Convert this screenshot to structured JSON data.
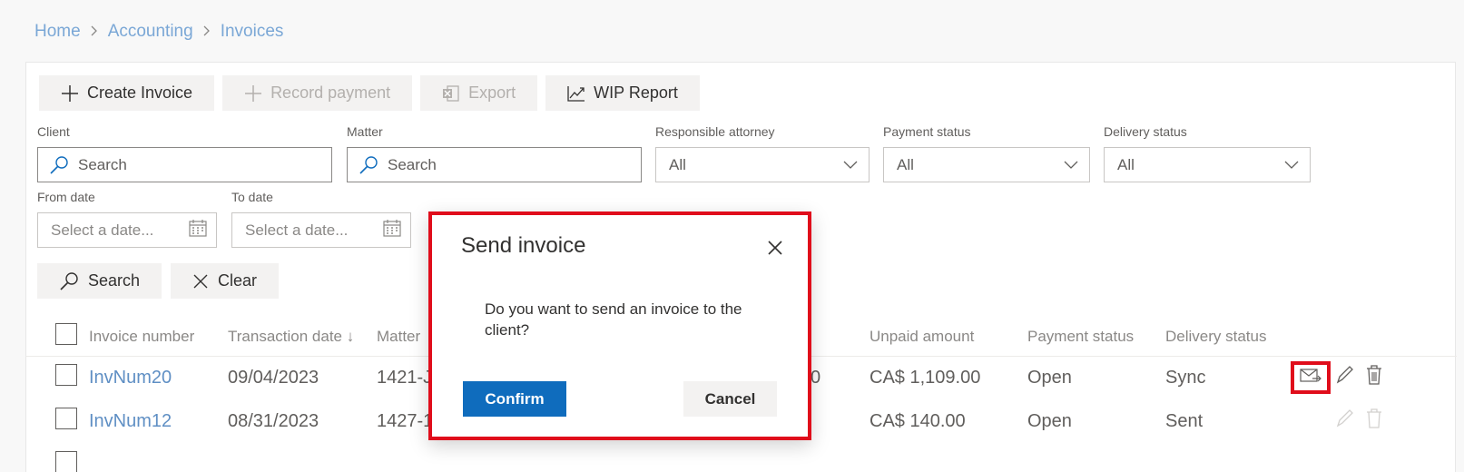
{
  "breadcrumb": {
    "home": "Home",
    "accounting": "Accounting",
    "invoices": "Invoices"
  },
  "toolbar": {
    "create_invoice": "Create Invoice",
    "record_payment": "Record payment",
    "export": "Export",
    "wip_report": "WIP Report"
  },
  "filters": {
    "client": {
      "label": "Client",
      "placeholder": "Search"
    },
    "matter": {
      "label": "Matter",
      "placeholder": "Search"
    },
    "responsible_attorney": {
      "label": "Responsible attorney",
      "value": "All"
    },
    "payment_status": {
      "label": "Payment status",
      "value": "All"
    },
    "delivery_status": {
      "label": "Delivery status",
      "value": "All"
    },
    "from_date": {
      "label": "From date",
      "placeholder": "Select a date..."
    },
    "to_date": {
      "label": "To date",
      "placeholder": "Select a date..."
    }
  },
  "actions": {
    "search": "Search",
    "clear": "Clear"
  },
  "table": {
    "headers": {
      "invoice_number": "Invoice number",
      "transaction_date": "Transaction date",
      "sort_arrow": "↓",
      "matter": "Matter",
      "unpaid_amount": "Unpaid amount",
      "payment_status": "Payment status",
      "delivery_status": "Delivery status"
    },
    "rows": [
      {
        "invoice": "InvNum20",
        "date": "09/04/2023",
        "matter": "1421-J",
        "amount_tail": "0",
        "unpaid": "CA$ 1,109.00",
        "payment": "Open",
        "delivery": "Sync"
      },
      {
        "invoice": "InvNum12",
        "date": "08/31/2023",
        "matter": "1427-1",
        "amount_tail": "",
        "unpaid": "CA$ 140.00",
        "payment": "Open",
        "delivery": "Sent"
      }
    ]
  },
  "dialog": {
    "title": "Send invoice",
    "message": "Do you want to send an invoice to the client?",
    "confirm": "Confirm",
    "cancel": "Cancel"
  },
  "colors": {
    "accent": "#0f6cbd",
    "highlight": "#e00d1b",
    "link": "#5f8fc4"
  },
  "icons": [
    "plus-icon",
    "excel-icon",
    "chart-line-icon",
    "search-icon",
    "chevron-down-icon",
    "calendar-icon",
    "close-icon",
    "mail-send-icon",
    "edit-icon",
    "delete-icon"
  ]
}
